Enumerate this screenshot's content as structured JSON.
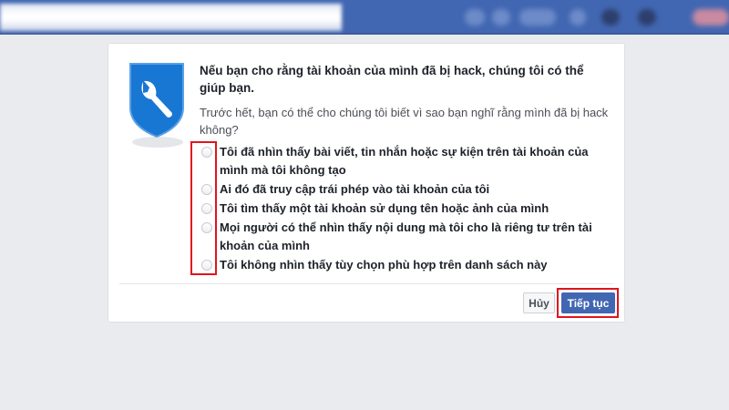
{
  "dialog": {
    "heading": "Nếu bạn cho rằng tài khoản của mình đã bị hack, chúng tôi có thể giúp bạn.",
    "subtitle": "Trước hết, bạn có thể cho chúng tôi biết vì sao bạn nghĩ rằng mình đã bị hack không?",
    "options": [
      "Tôi đã nhìn thấy bài viết, tin nhắn hoặc sự kiện trên tài khoản của mình mà tôi không tạo",
      "Ai đó đã truy cập trái phép vào tài khoản của tôi",
      "Tôi tìm thấy một tài khoản sử dụng tên hoặc ảnh của mình",
      "Mọi người có thể nhìn thấy nội dung mà tôi cho là riêng tư trên tài khoản của mình",
      "Tôi không nhìn thấy tùy chọn phù hợp trên danh sách này"
    ],
    "cancel_label": "Hủy",
    "continue_label": "Tiếp tục"
  },
  "colors": {
    "brand": "#4267b2",
    "highlight": "#e0141e",
    "shield": "#1877d2"
  }
}
